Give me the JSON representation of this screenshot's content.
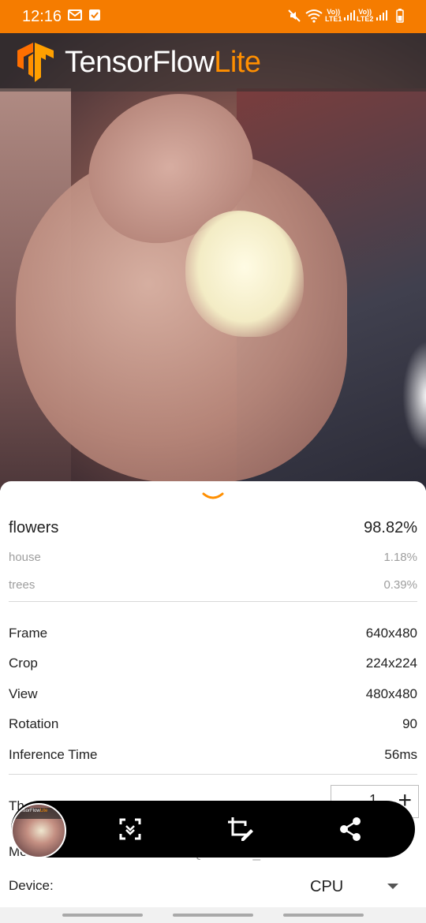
{
  "status_bar": {
    "time": "12:16",
    "left_icons": [
      "mail-sync-icon",
      "check-box-icon"
    ],
    "right_icons": [
      "mute-icon",
      "wifi-icon",
      "signal-lte1-icon",
      "signal-lte2-icon",
      "battery-icon"
    ],
    "sim1_label": "LTE1",
    "sim2_label": "LTE2",
    "volte_label": "Vo))",
    "background": "#f57c00"
  },
  "app_bar": {
    "brand_main": "TensorFlow",
    "brand_accent": "Lite",
    "accent_color": "#ff8f00"
  },
  "results": {
    "top": {
      "label": "flowers",
      "score": "98.82%"
    },
    "others": [
      {
        "label": "house",
        "score": "1.18%"
      },
      {
        "label": "trees",
        "score": "0.39%"
      }
    ]
  },
  "info": [
    {
      "key": "Frame",
      "value": "640x480"
    },
    {
      "key": "Crop",
      "value": "224x224"
    },
    {
      "key": "View",
      "value": "480x480"
    },
    {
      "key": "Rotation",
      "value": "90"
    },
    {
      "key": "Inference Time",
      "value": "56ms"
    }
  ],
  "settings": {
    "threads_label_partial": "Th",
    "threads_value": "1",
    "threads_plus": "+",
    "model_label_partial": "Mo",
    "model_value_partial": "Quantized_EfficientNet",
    "device_label": "Device:",
    "device_value": "CPU"
  },
  "toolbar": {
    "thumbnail_brand_main": "TensorFlow",
    "thumbnail_brand_accent": "Lite",
    "buttons": [
      "scan-icon",
      "crop-edit-icon",
      "share-icon"
    ]
  }
}
